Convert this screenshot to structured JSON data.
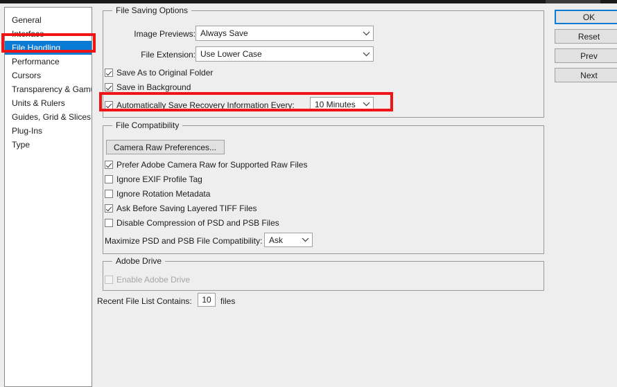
{
  "window": {
    "titlebar_visible": true
  },
  "sidebar": {
    "items": [
      {
        "label": "General",
        "selected": false
      },
      {
        "label": "Interface",
        "selected": false
      },
      {
        "label": "File Handling",
        "selected": true
      },
      {
        "label": "Performance",
        "selected": false
      },
      {
        "label": "Cursors",
        "selected": false
      },
      {
        "label": "Transparency & Gamut",
        "selected": false
      },
      {
        "label": "Units & Rulers",
        "selected": false
      },
      {
        "label": "Guides, Grid & Slices",
        "selected": false
      },
      {
        "label": "Plug-Ins",
        "selected": false
      },
      {
        "label": "Type",
        "selected": false
      }
    ]
  },
  "file_saving_options": {
    "legend": "File Saving Options",
    "image_previews_label": "Image Previews:",
    "image_previews_value": "Always Save",
    "file_extension_label": "File Extension:",
    "file_extension_value": "Use Lower Case",
    "save_as_original_folder": "Save As to Original Folder",
    "save_in_background": "Save in Background",
    "auto_save_recovery": "Automatically Save Recovery Information Every:",
    "auto_save_interval_value": "10 Minutes"
  },
  "file_compatibility": {
    "legend": "File Compatibility",
    "camera_raw_button": "Camera Raw Preferences...",
    "prefer_camera_raw": "Prefer Adobe Camera Raw for Supported Raw Files",
    "ignore_exif": "Ignore EXIF Profile Tag",
    "ignore_rotation": "Ignore Rotation Metadata",
    "ask_before_tiff": "Ask Before Saving Layered TIFF Files",
    "disable_compression": "Disable Compression of PSD and PSB Files",
    "maximize_label": "Maximize PSD and PSB File Compatibility:",
    "maximize_value": "Ask"
  },
  "adobe_drive": {
    "legend": "Adobe Drive",
    "enable_label": "Enable Adobe Drive"
  },
  "recent_files": {
    "label": "Recent File List Contains:",
    "value": "10",
    "suffix": "files"
  },
  "buttons": {
    "ok": "OK",
    "reset": "Reset",
    "prev": "Prev",
    "next": "Next"
  },
  "colors": {
    "accent": "#0a7bd4",
    "highlight": "#f01414",
    "dialog_bg": "#eeeeee",
    "field_bg": "#ffffff"
  }
}
